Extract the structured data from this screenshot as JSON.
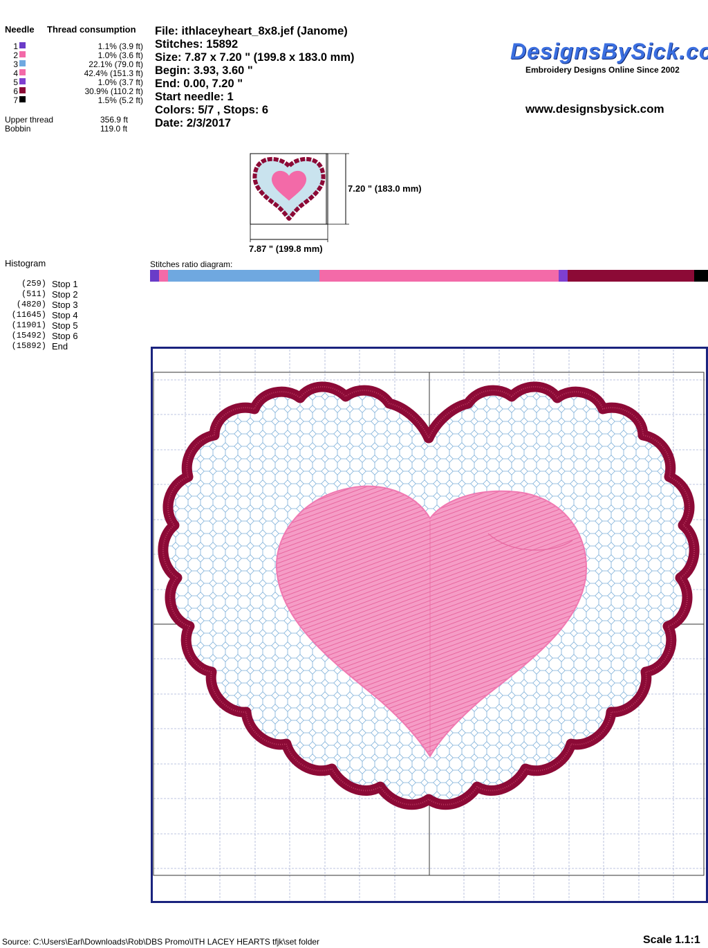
{
  "thread_table": {
    "needle_header": "Needle",
    "consumption_header": "Thread consumption",
    "rows": [
      {
        "needle": "1",
        "color": "#6a3cc8",
        "consumption": "1.1% (3.9 ft)"
      },
      {
        "needle": "2",
        "color": "#f36aa8",
        "consumption": "1.0% (3.6 ft)"
      },
      {
        "needle": "3",
        "color": "#6fa8e0",
        "consumption": "22.1% (79.0 ft)"
      },
      {
        "needle": "4",
        "color": "#f36aa8",
        "consumption": "42.4% (151.3 ft)"
      },
      {
        "needle": "5",
        "color": "#7e3fd0",
        "consumption": "1.0% (3.7 ft)"
      },
      {
        "needle": "6",
        "color": "#8c0a36",
        "consumption": "30.9% (110.2 ft)"
      },
      {
        "needle": "7",
        "color": "#000000",
        "consumption": "1.5% (5.2 ft)"
      }
    ],
    "upper_thread_label": "Upper thread",
    "upper_thread_value": "356.9 ft",
    "bobbin_label": "Bobbin",
    "bobbin_value": "119.0 ft"
  },
  "file_info": {
    "file": "File: ithlaceyheart_8x8.jef  (Janome)",
    "stitches": "Stitches: 15892",
    "size": "Size: 7.87 x 7.20 \" (199.8 x 183.0 mm)",
    "begin": "Begin: 3.93, 3.60 \"",
    "end": "End: 0.00, 7.20 \"",
    "start_needle": "Start needle: 1",
    "colors_stops": "Colors: 5/7 , Stops: 6",
    "date": "Date: 2/3/2017"
  },
  "brand": {
    "logo_text": "DesignsBySick.com",
    "tagline": "Embroidery Designs Online Since 2002",
    "website": "www.designsbysick.com"
  },
  "thumbnail": {
    "height_label": "7.20 \" (183.0 mm)",
    "width_label": "7.87 \" (199.8 mm)"
  },
  "histogram": {
    "title": "Histogram",
    "rows": [
      {
        "count": "(259)",
        "label": "Stop 1"
      },
      {
        "count": "(511)",
        "label": "Stop 2"
      },
      {
        "count": "(4820)",
        "label": "Stop 3"
      },
      {
        "count": "(11645)",
        "label": "Stop 4"
      },
      {
        "count": "(11901)",
        "label": "Stop 5"
      },
      {
        "count": "(15492)",
        "label": "Stop 6"
      },
      {
        "count": "(15892)",
        "label": "End"
      }
    ]
  },
  "ratio": {
    "title": "Stitches ratio diagram:",
    "segments": [
      {
        "color": "#6a3cc8",
        "fraction": 0.0163
      },
      {
        "color": "#f36aa8",
        "fraction": 0.0159
      },
      {
        "color": "#6fa8e0",
        "fraction": 0.2712
      },
      {
        "color": "#f36aa8",
        "fraction": 0.4294
      },
      {
        "color": "#7e3fd0",
        "fraction": 0.0161
      },
      {
        "color": "#8c0a36",
        "fraction": 0.2259
      },
      {
        "color": "#000000",
        "fraction": 0.0252
      }
    ]
  },
  "colors": {
    "border_dark": "#8c0a36",
    "lace_blue": "#7aaed8",
    "heart_pink": "#f07ab2",
    "frame_navy": "#1a237e",
    "grid": "#a9b3d6"
  },
  "footer": {
    "source": "Source: C:\\Users\\Earl\\Downloads\\Rob\\DBS Promo\\ITH LACEY HEARTS  tfjk\\set folder",
    "scale": "Scale 1.1:1"
  }
}
